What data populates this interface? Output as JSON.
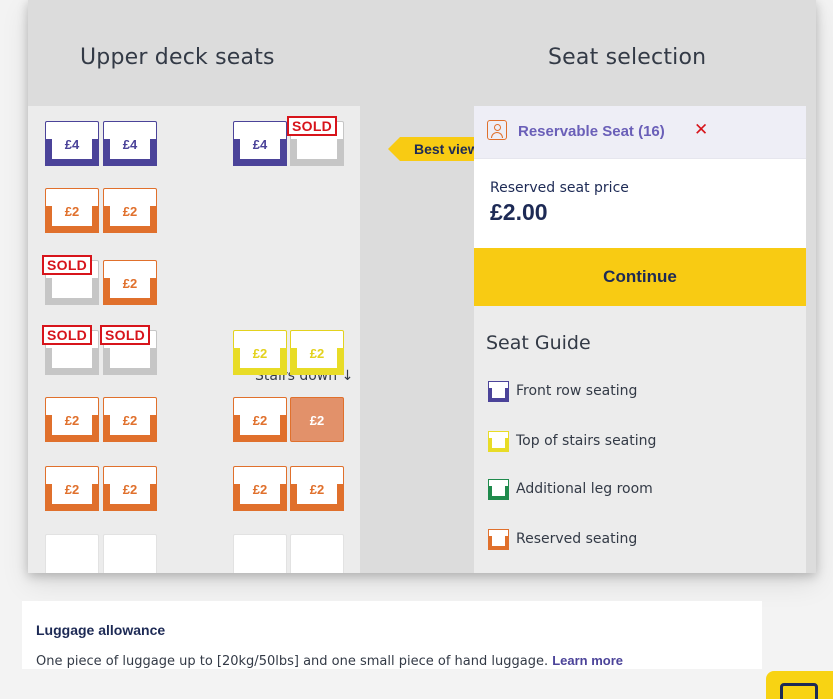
{
  "deck": {
    "title": "Upper deck seats",
    "stairs_label": "Stairs down",
    "best_view": "Best view!",
    "seats": [
      {
        "row": 0,
        "col": 0,
        "type": "purple",
        "price": "£4"
      },
      {
        "row": 0,
        "col": 1,
        "type": "purple",
        "price": "£4"
      },
      {
        "row": 0,
        "col": 2,
        "type": "purple",
        "price": "£4"
      },
      {
        "row": 0,
        "col": 3,
        "type": "soldseat",
        "price": "SOLD"
      },
      {
        "row": 1,
        "col": 0,
        "type": "orange",
        "price": "£2"
      },
      {
        "row": 1,
        "col": 1,
        "type": "orange",
        "price": "£2"
      },
      {
        "row": 2,
        "col": 0,
        "type": "soldseat",
        "price": "SOLD"
      },
      {
        "row": 2,
        "col": 1,
        "type": "orange",
        "price": "£2"
      },
      {
        "row": 3,
        "col": 0,
        "type": "soldseat",
        "price": "SOLD"
      },
      {
        "row": 3,
        "col": 1,
        "type": "soldseat",
        "price": "SOLD"
      },
      {
        "row": 3,
        "col": 2,
        "type": "yellow",
        "price": "£2"
      },
      {
        "row": 3,
        "col": 3,
        "type": "yellow",
        "price": "£2"
      },
      {
        "row": 4,
        "col": 0,
        "type": "orange",
        "price": "£2"
      },
      {
        "row": 4,
        "col": 1,
        "type": "orange",
        "price": "£2"
      },
      {
        "row": 4,
        "col": 2,
        "type": "orange",
        "price": "£2"
      },
      {
        "row": 4,
        "col": 3,
        "type": "selected",
        "price": "£2"
      },
      {
        "row": 5,
        "col": 0,
        "type": "orange",
        "price": "£2"
      },
      {
        "row": 5,
        "col": 1,
        "type": "orange",
        "price": "£2"
      },
      {
        "row": 5,
        "col": 2,
        "type": "orange",
        "price": "£2"
      },
      {
        "row": 5,
        "col": 3,
        "type": "orange",
        "price": "£2"
      },
      {
        "row": 6,
        "col": 0,
        "type": "blank",
        "price": ""
      },
      {
        "row": 6,
        "col": 1,
        "type": "blank",
        "price": ""
      },
      {
        "row": 6,
        "col": 2,
        "type": "blank",
        "price": ""
      },
      {
        "row": 6,
        "col": 3,
        "type": "blank",
        "price": ""
      }
    ]
  },
  "selection": {
    "title": "Seat selection",
    "chip_label": "Reservable Seat (16)",
    "close_glyph": "✕",
    "price_label": "Reserved seat price",
    "price_value": "£2.00",
    "continue_label": "Continue"
  },
  "guide": {
    "title": "Seat Guide",
    "items": [
      {
        "label": "Front row seating",
        "color": "#4b4399"
      },
      {
        "label": "Top of stairs seating",
        "color": "#e8dc27"
      },
      {
        "label": "Additional leg room",
        "color": "#1f8a4c"
      },
      {
        "label": "Reserved seating",
        "color": "#e0702c"
      }
    ]
  },
  "luggage": {
    "title": "Luggage allowance",
    "text": "One piece of luggage up to [20kg/50lbs] and one small piece of hand luggage. ",
    "link": "Learn more"
  }
}
